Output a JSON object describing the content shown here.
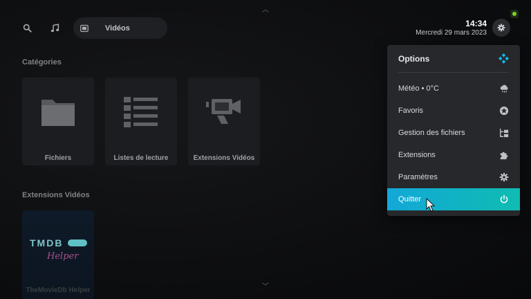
{
  "topbar": {
    "search_icon": "search-icon",
    "music_icon": "music-note-icon",
    "active_section": {
      "icon": "video-icon",
      "label": "Vidéos"
    }
  },
  "clock": {
    "time": "14:34",
    "date": "Mercredi 29 mars 2023"
  },
  "status": {
    "color": "#7ed321"
  },
  "categories": {
    "title": "Catégories",
    "tiles": [
      {
        "label": "Fichiers",
        "icon": "folder-icon"
      },
      {
        "label": "Listes de lecture",
        "icon": "list-icon"
      },
      {
        "label": "Extensions Vidéos",
        "icon": "camera-icon"
      }
    ]
  },
  "extensions": {
    "title": "Extensions Vidéos",
    "tiles": [
      {
        "label": "TheMovieDb Helper",
        "logo_text": "TMDB",
        "logo_script": "Helper"
      }
    ]
  },
  "menu": {
    "title": "Options",
    "items": [
      {
        "label": "Météo • 0°C",
        "icon": "weather-icon"
      },
      {
        "label": "Favoris",
        "icon": "star-icon"
      },
      {
        "label": "Gestion des fichiers",
        "icon": "file-manager-icon"
      },
      {
        "label": "Extensions",
        "icon": "puzzle-icon"
      },
      {
        "label": "Paramètres",
        "icon": "gear-icon"
      },
      {
        "label": "Quitter",
        "icon": "power-icon",
        "active": true
      }
    ]
  },
  "colors": {
    "accent_start": "#12a8d8",
    "accent_end": "#0fbcb1",
    "kodi_blue": "#17b2e7"
  }
}
